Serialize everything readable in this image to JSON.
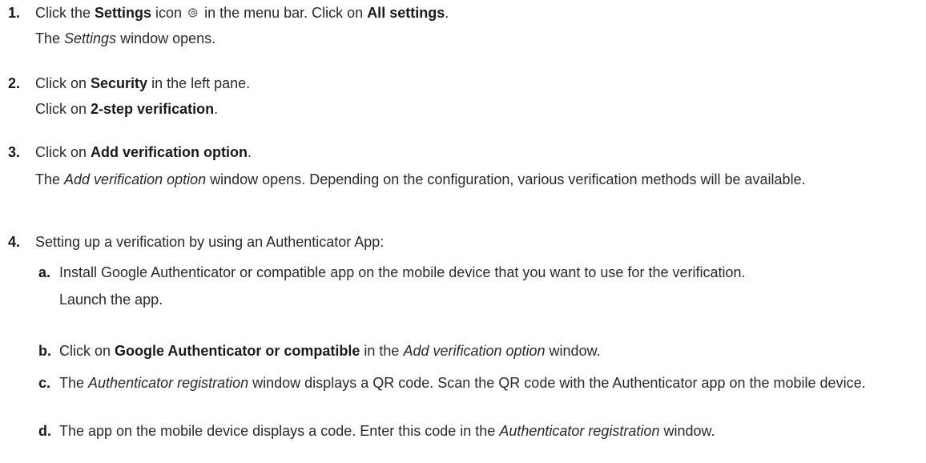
{
  "steps": [
    {
      "number": "1.",
      "line1_pre": "Click the ",
      "line1_settings": "Settings",
      "line1_icon_text": " icon ",
      "gear_icon": "gear-icon",
      "line1_mid": " in the menu bar. Click on ",
      "line1_all": "All settings",
      "line1_end": ".",
      "line2_pre": "The ",
      "line2_italic": "Settings",
      "line2_post": " window opens."
    },
    {
      "number": "2.",
      "line1_pre": "Click on ",
      "line1_bold": "Security",
      "line1_post": " in the left pane.",
      "line2_pre": "Click on ",
      "line2_bold": "2-step verification",
      "line2_post": "."
    },
    {
      "number": "3.",
      "line1_pre": "Click on ",
      "line1_bold": "Add verification option",
      "line1_post": ".",
      "line2_pre": "The ",
      "line2_italic": "Add verification option",
      "line2_post": " window opens. Depending on the configuration, various verification methods will be available."
    },
    {
      "number": "4.",
      "line1": "Setting up a verification by using an Authenticator App:",
      "substeps": [
        {
          "letter": "a.",
          "text1": "Install Google Authenticator or compatible app on the mobile device that you want to use for the verification.",
          "text2": "Launch the app."
        },
        {
          "letter": "b.",
          "pre": "Click on ",
          "bold": "Google Authenticator or compatible",
          "mid": " in the ",
          "italic": "Add verification option",
          "post": " window."
        },
        {
          "letter": "c.",
          "pre": "The ",
          "italic": "Authenticator registration",
          "post": " window displays a QR code. Scan the QR code with the Authenticator app on the mobile device."
        },
        {
          "letter": "d.",
          "pre": "The app on the mobile device displays a code. Enter this code in the ",
          "italic": "Authenticator registration",
          "post": " window."
        }
      ]
    }
  ]
}
